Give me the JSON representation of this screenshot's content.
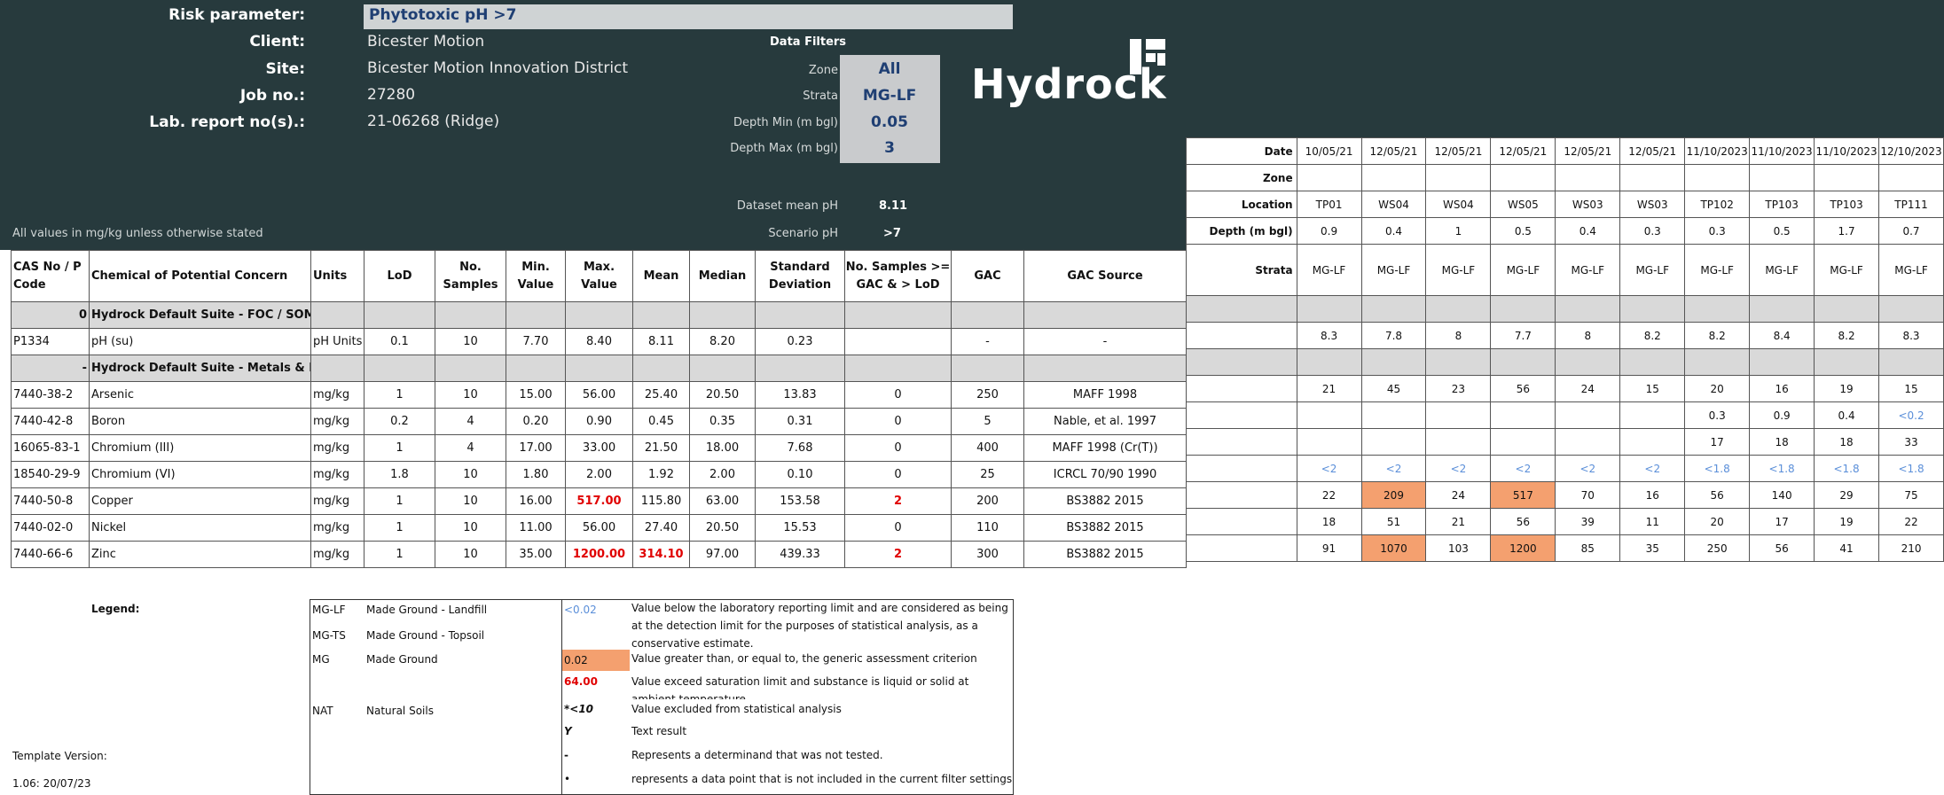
{
  "header": {
    "risk_parameter_label": "Risk parameter:",
    "risk_parameter_value": "Phytotoxic pH >7",
    "client_label": "Client:",
    "client_value": "Bicester Motion",
    "site_label": "Site:",
    "site_value": "Bicester Motion Innovation District",
    "job_label": "Job no.:",
    "job_value": "27280",
    "lab_label": "Lab. report no(s).:",
    "lab_value": "21-06268 (Ridge)",
    "units_note": "All values in mg/kg unless otherwise stated"
  },
  "filters": {
    "title": "Data Filters",
    "zone_label": "Zone",
    "zone_value": "All",
    "strata_label": "Strata",
    "strata_value": "MG-LF",
    "depth_min_label": "Depth Min (m bgl)",
    "depth_min_value": "0.05",
    "depth_max_label": "Depth Max (m bgl)",
    "depth_max_value": "3",
    "dataset_mean_label": "Dataset mean pH",
    "dataset_mean_value": "8.11",
    "scenario_label": "Scenario pH",
    "scenario_value": ">7"
  },
  "logo": {
    "text": "Hydrock"
  },
  "columns": [
    "CAS No / P Code",
    "Chemical of Potential Concern",
    "Units",
    "LoD",
    "No. Samples",
    "Min. Value",
    "Max. Value",
    "Mean",
    "Median",
    "Standard Deviation",
    "No. Samples >= GAC & > LoD",
    "GAC",
    "GAC Source"
  ],
  "groups": [
    {
      "code": "0",
      "name": "Hydrock Default Suite -  FOC / SOM / pH"
    },
    {
      "code": "-",
      "name": "Hydrock Default Suite - Metals & PAH"
    }
  ],
  "ph_row": {
    "cas": "P1334",
    "name": "pH (su)",
    "units": "pH Units",
    "lod": "0.1",
    "n": "10",
    "min": "7.70",
    "max": "8.40",
    "mean": "8.11",
    "median": "8.20",
    "sd": "0.23",
    "ngac": "",
    "gac": "-",
    "src": "-"
  },
  "rows": [
    {
      "cas": "7440-38-2",
      "name": "Arsenic",
      "units": "mg/kg",
      "lod": "1",
      "n": "10",
      "min": "15.00",
      "max": "56.00",
      "mean": "25.40",
      "median": "20.50",
      "sd": "13.83",
      "ngac": "0",
      "gac": "250",
      "src": "MAFF 1998"
    },
    {
      "cas": "7440-42-8",
      "name": "Boron",
      "units": "mg/kg",
      "lod": "0.2",
      "n": "4",
      "min": "0.20",
      "max": "0.90",
      "mean": "0.45",
      "median": "0.35",
      "sd": "0.31",
      "ngac": "0",
      "gac": "5",
      "src": "Nable, et al. 1997"
    },
    {
      "cas": "16065-83-1",
      "name": "Chromium (III)",
      "units": "mg/kg",
      "lod": "1",
      "n": "4",
      "min": "17.00",
      "max": "33.00",
      "mean": "21.50",
      "median": "18.00",
      "sd": "7.68",
      "ngac": "0",
      "gac": "400",
      "src": "MAFF 1998 (Cr(T))"
    },
    {
      "cas": "18540-29-9",
      "name": "Chromium (VI)",
      "units": "mg/kg",
      "lod": "1.8",
      "n": "10",
      "min": "1.80",
      "max": "2.00",
      "mean": "1.92",
      "median": "2.00",
      "sd": "0.10",
      "ngac": "0",
      "gac": "25",
      "src": "ICRCL 70/90 1990"
    },
    {
      "cas": "7440-50-8",
      "name": "Copper",
      "units": "mg/kg",
      "lod": "1",
      "n": "10",
      "min": "16.00",
      "max": "517.00",
      "mean": "115.80",
      "median": "63.00",
      "sd": "153.58",
      "ngac": "2",
      "gac": "200",
      "src": "BS3882 2015",
      "max_red": true,
      "ngac_red": true
    },
    {
      "cas": "7440-02-0",
      "name": "Nickel",
      "units": "mg/kg",
      "lod": "1",
      "n": "10",
      "min": "11.00",
      "max": "56.00",
      "mean": "27.40",
      "median": "20.50",
      "sd": "15.53",
      "ngac": "0",
      "gac": "110",
      "src": "BS3882 2015"
    },
    {
      "cas": "7440-66-6",
      "name": "Zinc",
      "units": "mg/kg",
      "lod": "1",
      "n": "10",
      "min": "35.00",
      "max": "1200.00",
      "mean": "314.10",
      "median": "97.00",
      "sd": "439.33",
      "ngac": "2",
      "gac": "300",
      "src": "BS3882 2015",
      "max_red": true,
      "mean_red": true,
      "ngac_red": true
    }
  ],
  "samples": {
    "row_labels": [
      "Date",
      "Zone",
      "Location",
      "Depth (m bgl)",
      "Strata"
    ],
    "dates": [
      "10/05/21",
      "12/05/21",
      "12/05/21",
      "12/05/21",
      "12/05/21",
      "12/05/21",
      "11/10/2023",
      "11/10/2023",
      "11/10/2023",
      "12/10/2023"
    ],
    "locations": [
      "TP01",
      "WS04",
      "WS04",
      "WS05",
      "WS03",
      "WS03",
      "TP102",
      "TP103",
      "TP103",
      "TP111"
    ],
    "depths": [
      "0.9",
      "0.4",
      "1",
      "0.5",
      "0.4",
      "0.3",
      "0.3",
      "0.5",
      "1.7",
      "0.7"
    ],
    "strata": [
      "MG-LF",
      "MG-LF",
      "MG-LF",
      "MG-LF",
      "MG-LF",
      "MG-LF",
      "MG-LF",
      "MG-LF",
      "MG-LF",
      "MG-LF"
    ],
    "ph": [
      "8.3",
      "7.8",
      "8",
      "7.7",
      "8",
      "8.2",
      "8.2",
      "8.4",
      "8.2",
      "8.3"
    ],
    "arsenic": [
      "21",
      "45",
      "23",
      "56",
      "24",
      "15",
      "20",
      "16",
      "19",
      "15"
    ],
    "boron": [
      "",
      "",
      "",
      "",
      "",
      "",
      "0.3",
      "0.9",
      "0.4",
      "<0.2"
    ],
    "cr3": [
      "",
      "",
      "",
      "",
      "",
      "",
      "17",
      "18",
      "18",
      "33"
    ],
    "cr6": [
      "<2",
      "<2",
      "<2",
      "<2",
      "<2",
      "<2",
      "<1.8",
      "<1.8",
      "<1.8",
      "<1.8"
    ],
    "copper": [
      "22",
      "209",
      "24",
      "517",
      "70",
      "16",
      "56",
      "140",
      "29",
      "75"
    ],
    "nickel": [
      "18",
      "51",
      "21",
      "56",
      "39",
      "11",
      "20",
      "17",
      "19",
      "22"
    ],
    "zinc": [
      "91",
      "1070",
      "103",
      "1200",
      "85",
      "35",
      "250",
      "56",
      "41",
      "210"
    ],
    "copper_exceed": [
      false,
      true,
      false,
      true,
      false,
      false,
      false,
      false,
      false,
      false
    ],
    "zinc_exceed": [
      false,
      true,
      false,
      true,
      false,
      false,
      false,
      false,
      false,
      false
    ]
  },
  "legend": {
    "title": "Legend:",
    "codes": [
      {
        "code": "MG-LF",
        "desc": "Made Ground - Landfill"
      },
      {
        "code": "MG-TS",
        "desc": "Made Ground - Topsoil"
      },
      {
        "code": "MG",
        "desc": "Made Ground"
      },
      {
        "code": "NAT",
        "desc": "Natural Soils"
      }
    ],
    "keys": [
      {
        "sym": "<0.02",
        "desc": "Value below the laboratory reporting limit and are considered as being at the detection limit for the purposes of statistical analysis, as a conservative estimate."
      },
      {
        "sym": "0.02",
        "desc": "Value greater than, or equal to, the generic assessment criterion (GAC)."
      },
      {
        "sym": "64.00",
        "desc": "Value exceed saturation limit and substance is liquid or solid at ambient temperature"
      },
      {
        "sym": "*<10",
        "desc": "Value excluded from statistical analysis"
      },
      {
        "sym": "Y",
        "desc": "Text result"
      },
      {
        "sym": "-",
        "desc": "Represents a determinand that was not tested."
      },
      {
        "sym": "•",
        "desc": "represents a data point that is not included in the current filter settings"
      }
    ]
  },
  "template": {
    "label": "Template Version:",
    "version": "1.06: 20/07/23"
  },
  "colors": {
    "header_bg": "#273a3d",
    "exceed": "#f4a06f",
    "below_lod": "#5b8fd9",
    "red": "#e00000"
  }
}
